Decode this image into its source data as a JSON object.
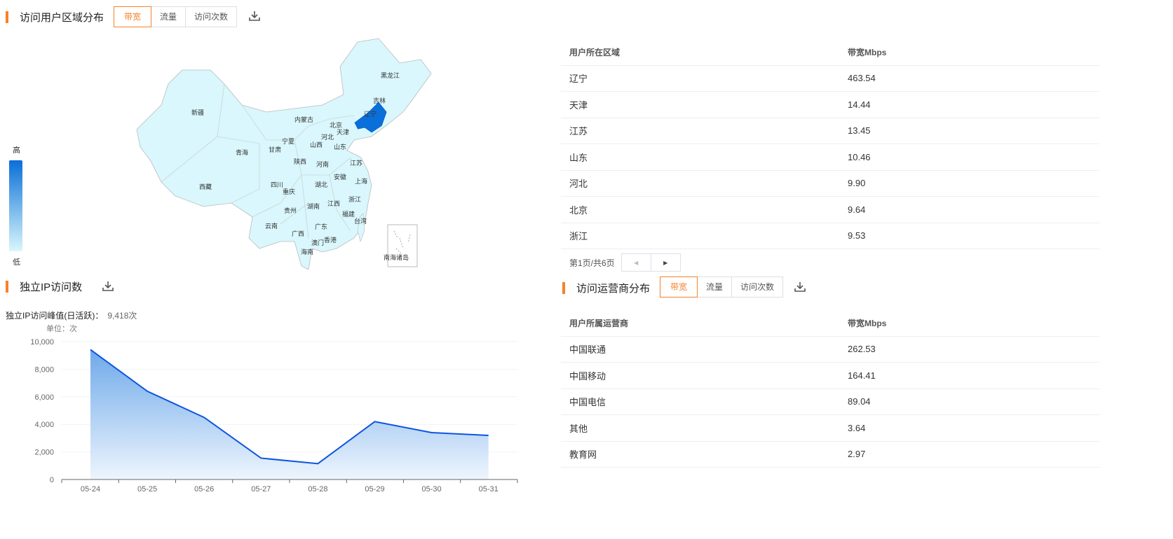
{
  "region": {
    "title": "访问用户区域分布",
    "tabs": [
      "带宽",
      "流量",
      "访问次数"
    ],
    "legend": {
      "high": "高",
      "low": "低",
      "high_color": "#0a6fd8",
      "low_color": "#d9f7fc"
    },
    "map_labels": [
      [
        "黑龙江",
        551,
        107
      ],
      [
        "吉林",
        540,
        143
      ],
      [
        "辽宁",
        527,
        162
      ],
      [
        "新疆",
        281,
        160
      ],
      [
        "内蒙古",
        428,
        170
      ],
      [
        "北京",
        478,
        178
      ],
      [
        "天津",
        488,
        188
      ],
      [
        "河北",
        466,
        195
      ],
      [
        "宁夏",
        410,
        201
      ],
      [
        "甘肃",
        391,
        213
      ],
      [
        "青海",
        344,
        217
      ],
      [
        "山西",
        450,
        206
      ],
      [
        "山东",
        484,
        209
      ],
      [
        "陕西",
        427,
        230
      ],
      [
        "河南",
        459,
        234
      ],
      [
        "江苏",
        507,
        232
      ],
      [
        "安徽",
        484,
        252
      ],
      [
        "上海",
        514,
        258
      ],
      [
        "西藏",
        292,
        266
      ],
      [
        "四川",
        394,
        263
      ],
      [
        "湖北",
        457,
        263
      ],
      [
        "重庆",
        411,
        273
      ],
      [
        "浙江",
        505,
        284
      ],
      [
        "江西",
        475,
        290
      ],
      [
        "湖南",
        446,
        294
      ],
      [
        "贵州",
        413,
        300
      ],
      [
        "福建",
        496,
        305
      ],
      [
        "台湾",
        513,
        315
      ],
      [
        "云南",
        386,
        322
      ],
      [
        "广西",
        424,
        333
      ],
      [
        "广东",
        457,
        323
      ],
      [
        "香港",
        470,
        342
      ],
      [
        "澳门",
        452,
        346
      ],
      [
        "海南",
        437,
        359
      ],
      [
        "南海诸岛",
        555,
        367
      ]
    ],
    "table": {
      "headers": [
        "用户所在区域",
        "带宽Mbps"
      ],
      "rows": [
        [
          "辽宁",
          "463.54"
        ],
        [
          "天津",
          "14.44"
        ],
        [
          "江苏",
          "13.45"
        ],
        [
          "山东",
          "10.46"
        ],
        [
          "河北",
          "9.90"
        ],
        [
          "北京",
          "9.64"
        ],
        [
          "浙江",
          "9.53"
        ]
      ]
    },
    "pager": "第1页/共6页"
  },
  "ip": {
    "title": "独立IP访问数",
    "peak_label": "独立IP访问峰值(日活跃)：",
    "peak_value": "9,418次",
    "unit": "单位：次"
  },
  "operator": {
    "title": "访问运营商分布",
    "tabs": [
      "带宽",
      "流量",
      "访问次数"
    ],
    "table": {
      "headers": [
        "用户所属运营商",
        "带宽Mbps"
      ],
      "rows": [
        [
          "中国联通",
          "262.53"
        ],
        [
          "中国移动",
          "164.41"
        ],
        [
          "中国电信",
          "89.04"
        ],
        [
          "其他",
          "3.64"
        ],
        [
          "教育网",
          "2.97"
        ]
      ]
    }
  },
  "chart_data": {
    "type": "area",
    "categories": [
      "05-24",
      "05-25",
      "05-26",
      "05-27",
      "05-28",
      "05-29",
      "05-30",
      "05-31"
    ],
    "values": [
      9418,
      6400,
      4500,
      1550,
      1150,
      4200,
      3400,
      3200
    ],
    "yticks": [
      0,
      2000,
      4000,
      6000,
      8000,
      10000
    ],
    "ytick_labels": [
      "0",
      "2,000",
      "4,000",
      "6,000",
      "8,000",
      "10,000"
    ],
    "ylim": [
      0,
      10000
    ],
    "ylabel": "单位：次",
    "line_color": "#0d55e0"
  }
}
